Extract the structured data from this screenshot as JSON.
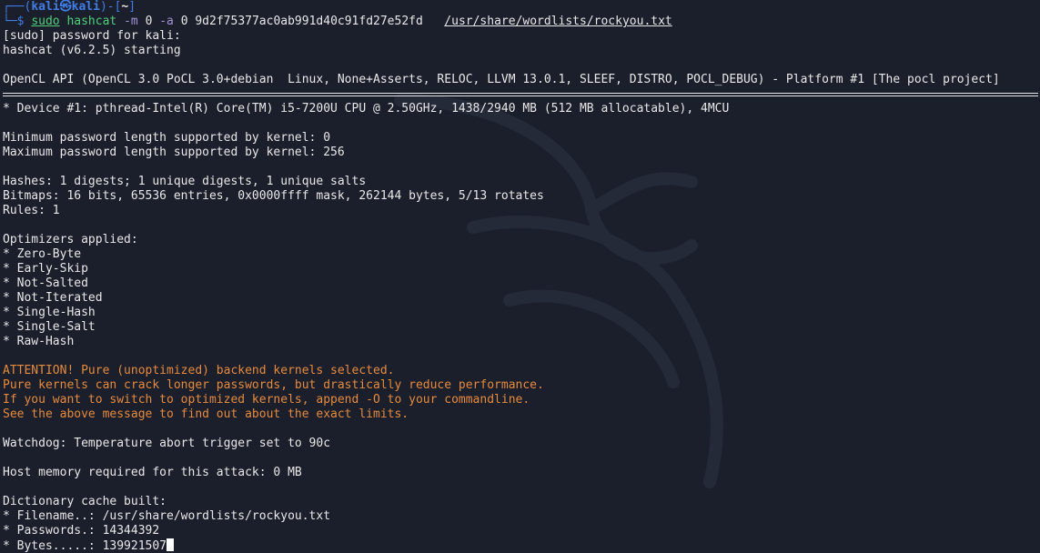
{
  "prompt": {
    "prefix": "┌──(",
    "user": "kali㉿kali",
    "mid": ")-[",
    "dir": "~",
    "suffix": "]",
    "arrow": "└─$ "
  },
  "command": {
    "sudo": "sudo",
    "program": "hashcat",
    "flag_m": "-m",
    "val_m": "0",
    "flag_a": "-a",
    "val_a": "0",
    "hash": "9d2f75377ac0ab991d40c91fd27e52fd",
    "wordlist": "/usr/share/wordlists/rockyou.txt"
  },
  "output": {
    "sudo_prompt": "[sudo] password for kali:",
    "starting": "hashcat (v6.2.5) starting",
    "opencl": "OpenCL API (OpenCL 3.0 PoCL 3.0+debian  Linux, None+Asserts, RELOC, LLVM 13.0.1, SLEEF, DISTRO, POCL_DEBUG) - Platform #1 [The pocl project]",
    "device": "* Device #1: pthread-Intel(R) Core(TM) i5-7200U CPU @ 2.50GHz, 1438/2940 MB (512 MB allocatable), 4MCU",
    "min_pw": "Minimum password length supported by kernel: 0",
    "max_pw": "Maximum password length supported by kernel: 256",
    "hashes": "Hashes: 1 digests; 1 unique digests, 1 unique salts",
    "bitmaps": "Bitmaps: 16 bits, 65536 entries, 0x0000ffff mask, 262144 bytes, 5/13 rotates",
    "rules": "Rules: 1",
    "optimizers_header": "Optimizers applied:",
    "optimizers": [
      "* Zero-Byte",
      "* Early-Skip",
      "* Not-Salted",
      "* Not-Iterated",
      "* Single-Hash",
      "* Single-Salt",
      "* Raw-Hash"
    ],
    "attention": [
      "ATTENTION! Pure (unoptimized) backend kernels selected.",
      "Pure kernels can crack longer passwords, but drastically reduce performance.",
      "If you want to switch to optimized kernels, append -O to your commandline.",
      "See the above message to find out about the exact limits."
    ],
    "watchdog": "Watchdog: Temperature abort trigger set to 90c",
    "host_mem": "Host memory required for this attack: 0 MB",
    "dict_header": "Dictionary cache built:",
    "dict_filename": "* Filename..: /usr/share/wordlists/rockyou.txt",
    "dict_passwords": "* Passwords.: 14344392",
    "dict_bytes": "* Bytes.....: 139921507"
  },
  "colors": {
    "background": "#1b1f2b",
    "prompt": "#3f7ee8",
    "command": "#4fd07a",
    "option": "#9f95d6",
    "warning": "#e68a3c"
  }
}
